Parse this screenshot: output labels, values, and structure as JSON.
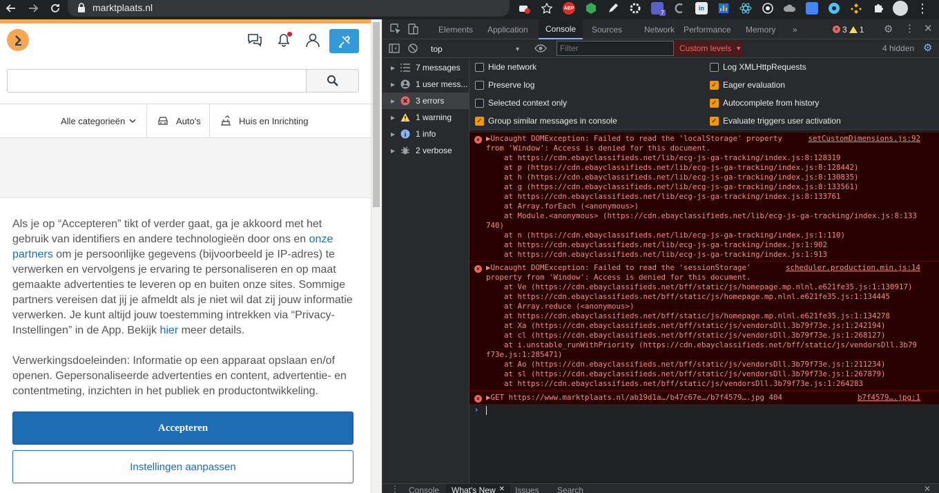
{
  "browser": {
    "url": "marktplaats.nl",
    "ext_abp": "ABP",
    "ext_badge": "7"
  },
  "page": {
    "categories": [
      "Alle categorieën",
      "Auto's",
      "Huis en Inrichting"
    ],
    "consent_parts": [
      "Als je op “Accepteren” tikt of verder gaat, ga je akkoord met het gebruik van identifiers en andere technologieën door ons en ",
      "onze partners",
      " om je persoonlijke gegevens (bijvoorbeeld je IP-adres) te verwerken en vervolgens je ervaring te personaliseren en op maat gemaakte advertenties te leveren op en buiten onze sites. Sommige partners vereisen dat jij je afmeldt als je niet wil dat zij jouw informatie verwerken. Je kunt altijd jouw toestemming intrekken via “Privacy-Instellingen” in de App. Bekijk ",
      "hier",
      " meer details."
    ],
    "purposes": "Verwerkingsdoeleinden: Informatie op een apparaat opslaan en/of openen. Gepersonaliseerde advertenties en content, advertentie- en contentmeting, inzichten in het publiek en productontwikkeling.",
    "accept_label": "Accepteren",
    "settings_label": "Instellingen aanpassen"
  },
  "devtools": {
    "tabs": [
      "Elements",
      "Application",
      "Console",
      "Sources",
      "Network",
      "Performance",
      "Memory"
    ],
    "more_tabs": "»",
    "error_count": "3",
    "warning_count": "1",
    "context": "top",
    "filter_placeholder": "Filter",
    "levels": "Custom levels",
    "hidden": "4 hidden",
    "sidebar": [
      {
        "label": "7 messages",
        "icon": "list"
      },
      {
        "label": "1 user mess...",
        "icon": "user"
      },
      {
        "label": "3 errors",
        "icon": "error"
      },
      {
        "label": "1 warning",
        "icon": "warning"
      },
      {
        "label": "1 info",
        "icon": "info"
      },
      {
        "label": "2 verbose",
        "icon": "verbose"
      }
    ],
    "settings_left": [
      {
        "label": "Hide network",
        "checked": false
      },
      {
        "label": "Preserve log",
        "checked": false
      },
      {
        "label": "Selected context only",
        "checked": false
      },
      {
        "label": "Group similar messages in console",
        "checked": true
      }
    ],
    "settings_right": [
      {
        "label": "Log XMLHttpRequests",
        "checked": false
      },
      {
        "label": "Eager evaluation",
        "checked": true
      },
      {
        "label": "Autocomplete from history",
        "checked": true
      },
      {
        "label": "Evaluate triggers user activation",
        "checked": true
      }
    ],
    "errors": [
      {
        "source": "setCustomDimensions.js:92",
        "lines": [
          "▶Uncaught DOMException: Failed to read the 'localStorage' property",
          "from 'Window': Access is denied for this document.",
          "    at https://cdn.ebayclassifieds.net/lib/ecg-js-ga-tracking/index.js:8:128319",
          "    at p (https://cdn.ebayclassifieds.net/lib/ecg-js-ga-tracking/index.js:8:128442)",
          "    at h (https://cdn.ebayclassifieds.net/lib/ecg-js-ga-tracking/index.js:8:130835)",
          "    at g (https://cdn.ebayclassifieds.net/lib/ecg-js-ga-tracking/index.js:8:133561)",
          "    at https://cdn.ebayclassifieds.net/lib/ecg-js-ga-tracking/index.js:8:133761",
          "    at Array.forEach (<anonymous>)",
          "    at Module.<anonymous> (https://cdn.ebayclassifieds.net/lib/ecg-js-ga-tracking/index.js:8:133",
          "740)",
          "    at n (https://cdn.ebayclassifieds.net/lib/ecg-js-ga-tracking/index.js:1:110)",
          "    at https://cdn.ebayclassifieds.net/lib/ecg-js-ga-tracking/index.js:1:902",
          "    at https://cdn.ebayclassifieds.net/lib/ecg-js-ga-tracking/index.js:1:913"
        ]
      },
      {
        "source": "scheduler.production.min.js:14",
        "lines": [
          "▶Uncaught DOMException: Failed to read the 'sessionStorage'",
          "property from 'Window': Access is denied for this document.",
          "    at Ve (https://cdn.ebayclassifieds.net/bff/static/js/homepage.mp.nlnl.e621fe35.js:1:130917)",
          "    at https://cdn.ebayclassifieds.net/bff/static/js/homepage.mp.nlnl.e621fe35.js:1:134445",
          "    at Array.reduce (<anonymous>)",
          "    at https://cdn.ebayclassifieds.net/bff/static/js/homepage.mp.nlnl.e621fe35.js:1:134278",
          "    at Xa (https://cdn.ebayclassifieds.net/bff/static/js/vendorsDll.3b79f73e.js:1:242194)",
          "    at cl (https://cdn.ebayclassifieds.net/bff/static/js/vendorsDll.3b79f73e.js:1:268127)",
          "    at i.unstable_runWithPriority (https://cdn.ebayclassifieds.net/bff/static/js/vendorsDll.3b79",
          "f73e.js:1:285471)",
          "    at Ao (https://cdn.ebayclassifieds.net/bff/static/js/vendorsDll.3b79f73e.js:1:211234)",
          "    at sl (https://cdn.ebayclassifieds.net/bff/static/js/vendorsDll.3b79f73e.js:1:267879)",
          "    at https://cdn.ebayclassifieds.net/bff/static/js/vendorsDll.3b79f73e.js:1:264283"
        ]
      },
      {
        "source": "b7f4579….jpg:1",
        "lines": [
          "▶GET https://www.marktplaats.nl/ab19d1a…/b47c67e…/b7f4579….jpg 404"
        ]
      }
    ],
    "prompt": "›",
    "drawer_tabs": [
      "Console",
      "What's New",
      "Issues",
      "Search"
    ]
  }
}
